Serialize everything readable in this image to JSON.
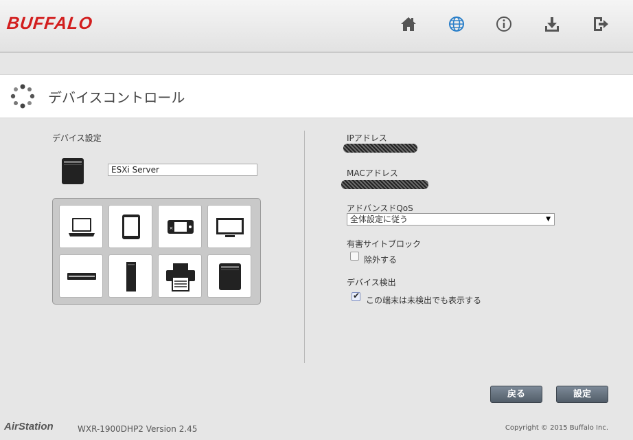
{
  "header": {
    "logo": "BUFFALO",
    "nav": [
      {
        "name": "home-icon"
      },
      {
        "name": "internet-globe-icon"
      },
      {
        "name": "info-icon"
      },
      {
        "name": "download-icon"
      },
      {
        "name": "logout-icon"
      }
    ]
  },
  "page": {
    "title": "デバイスコントロール",
    "title_icon": "spinner-dots-icon"
  },
  "left": {
    "section_label": "デバイス設定",
    "device_name": "ESXi Server",
    "device_types": [
      "laptop-icon",
      "tablet-icon",
      "game-console-icon",
      "tv-icon",
      "recorder-icon",
      "tower-pc-icon",
      "printer-icon",
      "nas-icon"
    ]
  },
  "right": {
    "ip_label": "IPアドレス",
    "mac_label": "MACアドレス",
    "qos_label": "アドバンスドQoS",
    "qos_selected": "全体設定に従う",
    "block_label": "有害サイトブロック",
    "block_option": "除外する",
    "block_checked": false,
    "detect_label": "デバイス検出",
    "detect_option": "この端末は未検出でも表示する",
    "detect_checked": true
  },
  "buttons": {
    "back": "戻る",
    "apply": "設定"
  },
  "footer": {
    "brand": "AirStation",
    "model": "WXR-1900DHP2   Version 2.45",
    "copyright": "Copyright © 2015 Buffalo Inc."
  },
  "colors": {
    "logo_red": "#d21e1e",
    "globe_blue": "#2a7fc9",
    "button_gray": "#5f6b78"
  }
}
